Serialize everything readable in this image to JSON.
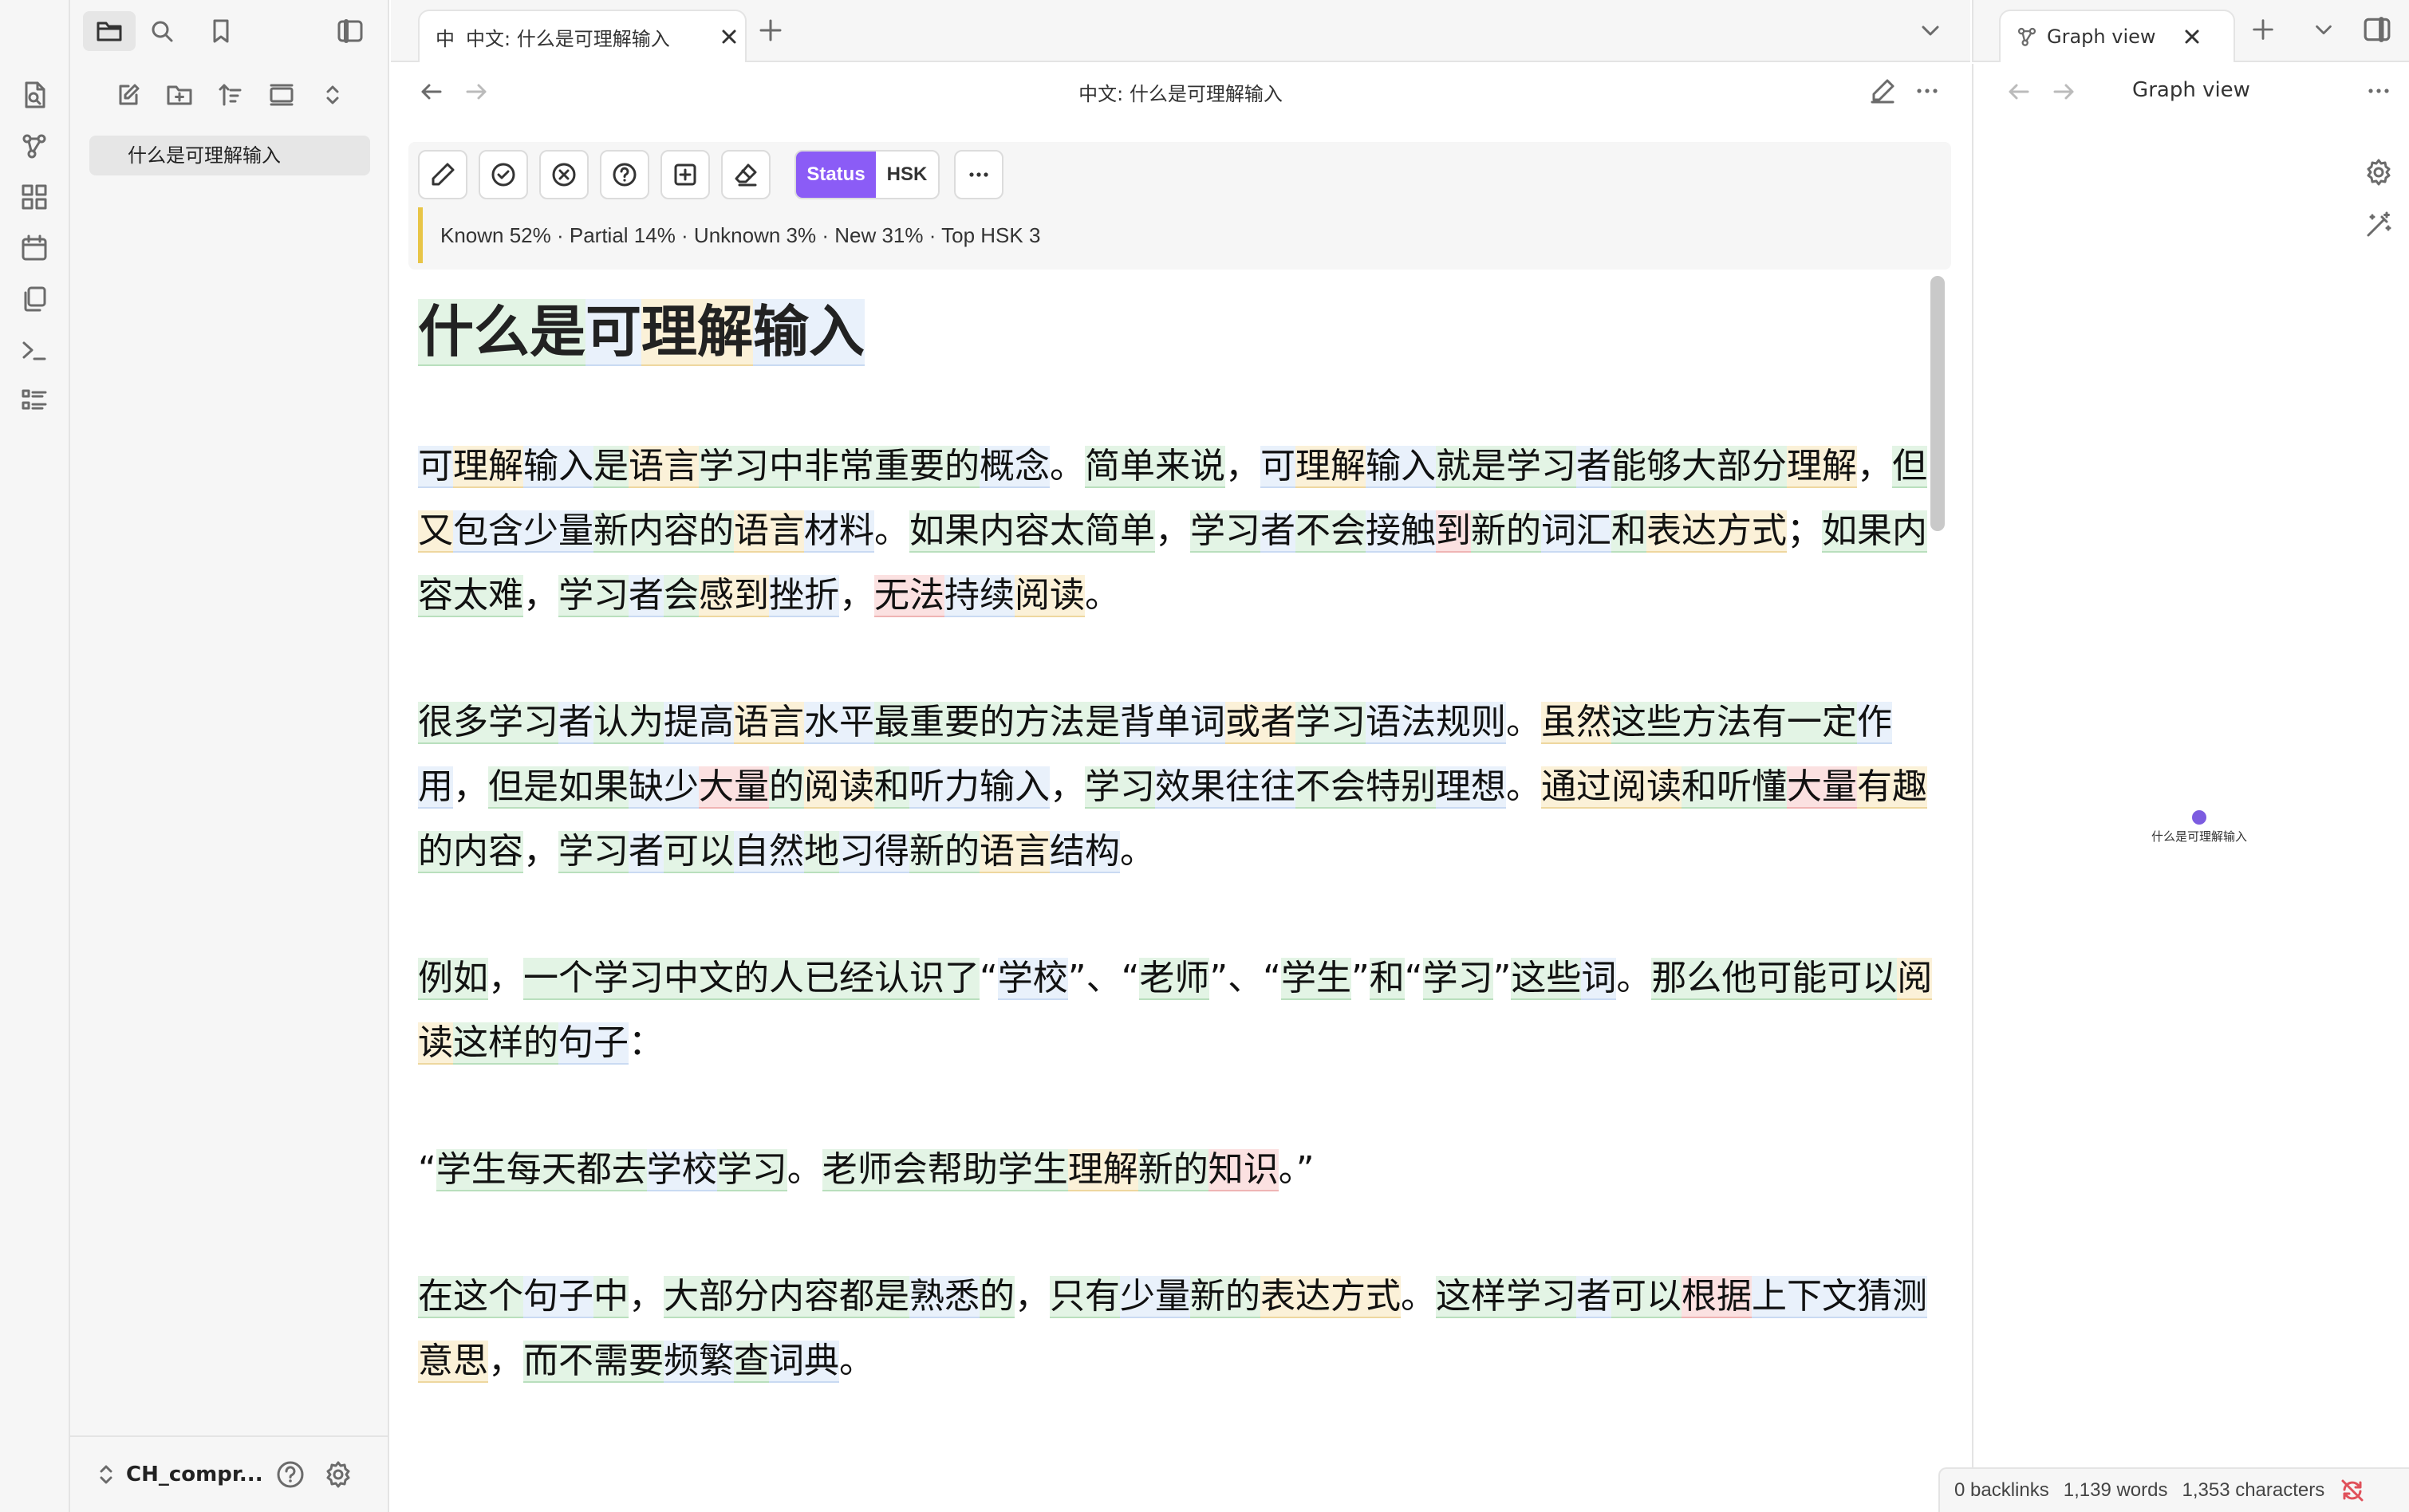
{
  "ribbon": {
    "items": [
      "file-search-icon",
      "graph-icon",
      "canvas-icon",
      "calendar-icon",
      "copy-icon",
      "terminal-icon",
      "list-icon"
    ]
  },
  "sidebar": {
    "file_name": "什么是可理解输入",
    "vault_name": "CH_compr..."
  },
  "tabs": {
    "main_tab_icon": "中",
    "main_tab_label": "中文: 什么是可理解输入",
    "graph_tab_label": "Graph view"
  },
  "editor": {
    "note_title": "中文: 什么是可理解输入",
    "toolbar": {
      "status_label": "Status",
      "hsk_label": "HSK"
    },
    "stats": "Known 52% · Partial 14% · Unknown 3% · New 31% · Top HSK 3",
    "heading_segments": [
      {
        "t": "什么",
        "c": "k"
      },
      {
        "t": "是",
        "c": "k"
      },
      {
        "t": "可",
        "c": "n"
      },
      {
        "t": "理解",
        "c": "p"
      },
      {
        "t": "输入",
        "c": "n"
      }
    ],
    "paragraphs": [
      [
        {
          "t": "可",
          "c": "n"
        },
        {
          "t": "理解",
          "c": "p"
        },
        {
          "t": "输入",
          "c": "n"
        },
        {
          "t": "是",
          "c": "k"
        },
        {
          "t": "语言",
          "c": "p"
        },
        {
          "t": "学习",
          "c": "k"
        },
        {
          "t": "中",
          "c": "k"
        },
        {
          "t": "非常",
          "c": "k"
        },
        {
          "t": "重要",
          "c": "k"
        },
        {
          "t": "的",
          "c": "k"
        },
        {
          "t": "概念",
          "c": "n"
        },
        {
          "t": "。",
          "c": ""
        },
        {
          "t": "简单",
          "c": "k"
        },
        {
          "t": "来说",
          "c": "k"
        },
        {
          "t": "，",
          "c": ""
        },
        {
          "t": "可",
          "c": "n"
        },
        {
          "t": "理解",
          "c": "p"
        },
        {
          "t": "输入",
          "c": "n"
        },
        {
          "t": "就",
          "c": "k"
        },
        {
          "t": "是",
          "c": "k"
        },
        {
          "t": "学习",
          "c": "k"
        },
        {
          "t": "者",
          "c": "n"
        },
        {
          "t": "能够",
          "c": "k"
        },
        {
          "t": "大部分",
          "c": "k"
        },
        {
          "t": "理解",
          "c": "p"
        },
        {
          "t": "，",
          "c": ""
        },
        {
          "t": "但",
          "c": "k"
        },
        {
          "t": "又",
          "c": "p"
        },
        {
          "t": "包含",
          "c": "n"
        },
        {
          "t": "少量",
          "c": "n"
        },
        {
          "t": "新",
          "c": "k"
        },
        {
          "t": "内容",
          "c": "k"
        },
        {
          "t": "的",
          "c": "k"
        },
        {
          "t": "语言",
          "c": "p"
        },
        {
          "t": "材料",
          "c": "n"
        },
        {
          "t": "。",
          "c": ""
        },
        {
          "t": "如果",
          "c": "k"
        },
        {
          "t": "内容",
          "c": "k"
        },
        {
          "t": "太",
          "c": "k"
        },
        {
          "t": "简单",
          "c": "k"
        },
        {
          "t": "，",
          "c": ""
        },
        {
          "t": "学习",
          "c": "k"
        },
        {
          "t": "者",
          "c": "n"
        },
        {
          "t": "不会",
          "c": "k"
        },
        {
          "t": "接触",
          "c": "n"
        },
        {
          "t": "到",
          "c": "u"
        },
        {
          "t": "新",
          "c": "k"
        },
        {
          "t": "的",
          "c": "k"
        },
        {
          "t": "词汇",
          "c": "n"
        },
        {
          "t": "和",
          "c": "k"
        },
        {
          "t": "表达",
          "c": "p"
        },
        {
          "t": "方式",
          "c": "p"
        },
        {
          "t": "；",
          "c": ""
        },
        {
          "t": "如果",
          "c": "k"
        },
        {
          "t": "内容",
          "c": "k"
        },
        {
          "t": "太",
          "c": "k"
        },
        {
          "t": "难",
          "c": "k"
        },
        {
          "t": "，",
          "c": ""
        },
        {
          "t": "学习",
          "c": "k"
        },
        {
          "t": "者",
          "c": "n"
        },
        {
          "t": "会",
          "c": "k"
        },
        {
          "t": "感到",
          "c": "p"
        },
        {
          "t": "挫折",
          "c": "n"
        },
        {
          "t": "，",
          "c": ""
        },
        {
          "t": "无法",
          "c": "u"
        },
        {
          "t": "持续",
          "c": "n"
        },
        {
          "t": "阅读",
          "c": "p"
        },
        {
          "t": "。",
          "c": ""
        }
      ],
      [
        {
          "t": "很多",
          "c": "k"
        },
        {
          "t": "学习",
          "c": "k"
        },
        {
          "t": "者",
          "c": "n"
        },
        {
          "t": "认为",
          "c": "k"
        },
        {
          "t": "提高",
          "c": "n"
        },
        {
          "t": "语言",
          "c": "p"
        },
        {
          "t": "水平",
          "c": "n"
        },
        {
          "t": "最",
          "c": "k"
        },
        {
          "t": "重要",
          "c": "k"
        },
        {
          "t": "的",
          "c": "k"
        },
        {
          "t": "方法",
          "c": "k"
        },
        {
          "t": "是",
          "c": "k"
        },
        {
          "t": "背",
          "c": "n"
        },
        {
          "t": "单词",
          "c": "n"
        },
        {
          "t": "或者",
          "c": "p"
        },
        {
          "t": "学习",
          "c": "k"
        },
        {
          "t": "语法",
          "c": "n"
        },
        {
          "t": "规则",
          "c": "n"
        },
        {
          "t": "。",
          "c": ""
        },
        {
          "t": "虽然",
          "c": "p"
        },
        {
          "t": "这些",
          "c": "k"
        },
        {
          "t": "方法",
          "c": "k"
        },
        {
          "t": "有",
          "c": "k"
        },
        {
          "t": "一定",
          "c": "k"
        },
        {
          "t": "作用",
          "c": "n"
        },
        {
          "t": "，",
          "c": ""
        },
        {
          "t": "但是",
          "c": "k"
        },
        {
          "t": "如果",
          "c": "k"
        },
        {
          "t": "缺少",
          "c": "n"
        },
        {
          "t": "大量",
          "c": "u"
        },
        {
          "t": "的",
          "c": "k"
        },
        {
          "t": "阅读",
          "c": "p"
        },
        {
          "t": "和",
          "c": "k"
        },
        {
          "t": "听力",
          "c": "n"
        },
        {
          "t": "输入",
          "c": "n"
        },
        {
          "t": "，",
          "c": ""
        },
        {
          "t": "学习",
          "c": "k"
        },
        {
          "t": "效果",
          "c": "n"
        },
        {
          "t": "往往",
          "c": "n"
        },
        {
          "t": "不会",
          "c": "k"
        },
        {
          "t": "特别",
          "c": "k"
        },
        {
          "t": "理想",
          "c": "n"
        },
        {
          "t": "。",
          "c": ""
        },
        {
          "t": "通过",
          "c": "p"
        },
        {
          "t": "阅读",
          "c": "p"
        },
        {
          "t": "和",
          "c": "k"
        },
        {
          "t": "听懂",
          "c": "k"
        },
        {
          "t": "大量",
          "c": "u"
        },
        {
          "t": "有趣",
          "c": "p"
        },
        {
          "t": "的",
          "c": "k"
        },
        {
          "t": "内容",
          "c": "k"
        },
        {
          "t": "，",
          "c": ""
        },
        {
          "t": "学习",
          "c": "k"
        },
        {
          "t": "者",
          "c": "n"
        },
        {
          "t": "可以",
          "c": "k"
        },
        {
          "t": "自然",
          "c": "n"
        },
        {
          "t": "地",
          "c": "k"
        },
        {
          "t": "习得",
          "c": "n"
        },
        {
          "t": "新",
          "c": "k"
        },
        {
          "t": "的",
          "c": "k"
        },
        {
          "t": "语言",
          "c": "p"
        },
        {
          "t": "结构",
          "c": "n"
        },
        {
          "t": "。",
          "c": ""
        }
      ],
      [
        {
          "t": "例如",
          "c": "k"
        },
        {
          "t": "，",
          "c": ""
        },
        {
          "t": "一个",
          "c": "k"
        },
        {
          "t": "学习",
          "c": "k"
        },
        {
          "t": "中文",
          "c": "k"
        },
        {
          "t": "的",
          "c": "k"
        },
        {
          "t": "人",
          "c": "k"
        },
        {
          "t": "已经",
          "c": "k"
        },
        {
          "t": "认识",
          "c": "k"
        },
        {
          "t": "了",
          "c": "k"
        },
        {
          "t": "“",
          "c": ""
        },
        {
          "t": "学校",
          "c": "n"
        },
        {
          "t": "”、“",
          "c": ""
        },
        {
          "t": "老师",
          "c": "k"
        },
        {
          "t": "”、“",
          "c": ""
        },
        {
          "t": "学生",
          "c": "k"
        },
        {
          "t": "”",
          "c": ""
        },
        {
          "t": "和",
          "c": "k"
        },
        {
          "t": "“",
          "c": ""
        },
        {
          "t": "学习",
          "c": "k"
        },
        {
          "t": "”",
          "c": ""
        },
        {
          "t": "这些",
          "c": "k"
        },
        {
          "t": "词",
          "c": "n"
        },
        {
          "t": "。",
          "c": ""
        },
        {
          "t": "那么",
          "c": "k"
        },
        {
          "t": "他",
          "c": "k"
        },
        {
          "t": "可能",
          "c": "k"
        },
        {
          "t": "可以",
          "c": "k"
        },
        {
          "t": "阅读",
          "c": "p"
        },
        {
          "t": "这样",
          "c": "k"
        },
        {
          "t": "的",
          "c": "k"
        },
        {
          "t": "句子",
          "c": "n"
        },
        {
          "t": "：",
          "c": ""
        }
      ],
      [
        {
          "t": "“",
          "c": ""
        },
        {
          "t": "学生",
          "c": "k"
        },
        {
          "t": "每天",
          "c": "k"
        },
        {
          "t": "都",
          "c": "k"
        },
        {
          "t": "去",
          "c": "k"
        },
        {
          "t": "学校",
          "c": "n"
        },
        {
          "t": "学习",
          "c": "k"
        },
        {
          "t": "。",
          "c": ""
        },
        {
          "t": "老师",
          "c": "k"
        },
        {
          "t": "会",
          "c": "k"
        },
        {
          "t": "帮助",
          "c": "k"
        },
        {
          "t": "学生",
          "c": "k"
        },
        {
          "t": "理解",
          "c": "p"
        },
        {
          "t": "新",
          "c": "k"
        },
        {
          "t": "的",
          "c": "k"
        },
        {
          "t": "知识",
          "c": "u"
        },
        {
          "t": "。”",
          "c": ""
        }
      ],
      [
        {
          "t": "在",
          "c": "k"
        },
        {
          "t": "这个",
          "c": "k"
        },
        {
          "t": "句子",
          "c": "n"
        },
        {
          "t": "中",
          "c": "k"
        },
        {
          "t": "，",
          "c": ""
        },
        {
          "t": "大部分",
          "c": "k"
        },
        {
          "t": "内容",
          "c": "k"
        },
        {
          "t": "都",
          "c": "k"
        },
        {
          "t": "是",
          "c": "k"
        },
        {
          "t": "熟悉",
          "c": "n"
        },
        {
          "t": "的",
          "c": "k"
        },
        {
          "t": "，",
          "c": ""
        },
        {
          "t": "只有",
          "c": "k"
        },
        {
          "t": "少量",
          "c": "n"
        },
        {
          "t": "新",
          "c": "k"
        },
        {
          "t": "的",
          "c": "k"
        },
        {
          "t": "表达",
          "c": "p"
        },
        {
          "t": "方式",
          "c": "p"
        },
        {
          "t": "。",
          "c": ""
        },
        {
          "t": "这样",
          "c": "k"
        },
        {
          "t": "学习",
          "c": "k"
        },
        {
          "t": "者",
          "c": "n"
        },
        {
          "t": "可以",
          "c": "k"
        },
        {
          "t": "根据",
          "c": "u"
        },
        {
          "t": "上下文",
          "c": "n"
        },
        {
          "t": "猜测",
          "c": "n"
        },
        {
          "t": "意思",
          "c": "p"
        },
        {
          "t": "，",
          "c": ""
        },
        {
          "t": "而",
          "c": "k"
        },
        {
          "t": "不",
          "c": "k"
        },
        {
          "t": "需要",
          "c": "k"
        },
        {
          "t": "频繁",
          "c": "n"
        },
        {
          "t": "查",
          "c": "k"
        },
        {
          "t": "词典",
          "c": "n"
        },
        {
          "t": "。",
          "c": ""
        }
      ]
    ]
  },
  "graph": {
    "header": "Graph view",
    "node_label": "什么是可理解输入"
  },
  "statusbar": {
    "backlinks": "0 backlinks",
    "words": "1,139 words",
    "characters": "1,353 characters"
  },
  "colors": {
    "accent": "#8b5cf6",
    "known": "#e3f4e5",
    "partial": "#fbf1d8",
    "new": "#e9f1fb",
    "unknown": "#fbe1e1"
  }
}
